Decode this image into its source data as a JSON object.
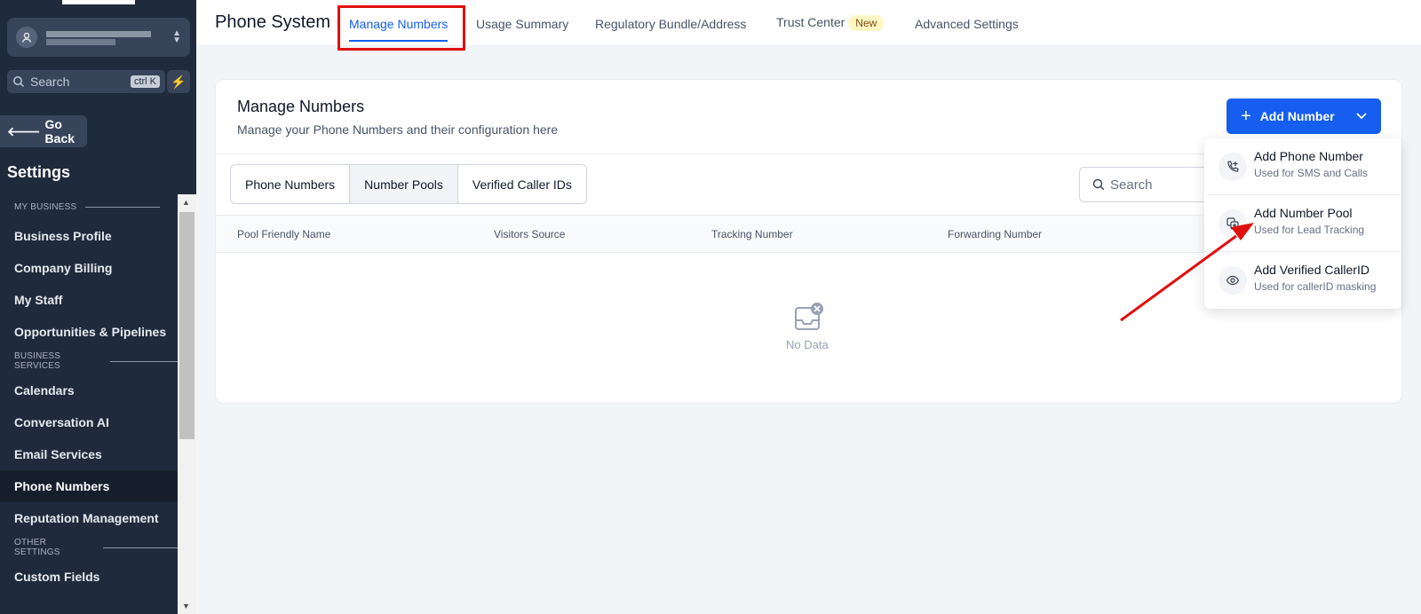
{
  "sidebar": {
    "search_placeholder": "Search",
    "search_shortcut": "ctrl K",
    "go_back": "Go Back",
    "settings_title": "Settings",
    "sections": [
      {
        "label": "MY BUSINESS",
        "items": [
          "Business Profile",
          "Company Billing",
          "My Staff",
          "Opportunities & Pipelines"
        ]
      },
      {
        "label": "BUSINESS SERVICES",
        "items": [
          "Calendars",
          "Conversation AI",
          "Email Services",
          "Phone Numbers",
          "Reputation Management"
        ]
      },
      {
        "label": "OTHER SETTINGS",
        "items": [
          "Custom Fields"
        ]
      }
    ],
    "active_item": "Phone Numbers"
  },
  "header": {
    "title": "Phone System",
    "tabs": [
      "Manage Numbers",
      "Usage Summary",
      "Regulatory Bundle/Address",
      "Trust Center",
      "Advanced Settings"
    ],
    "trust_center_badge": "New",
    "active_tab": "Manage Numbers"
  },
  "card": {
    "title": "Manage Numbers",
    "subtitle": "Manage your Phone Numbers and their configuration here",
    "add_button": "Add Number",
    "segments": [
      "Phone Numbers",
      "Number Pools",
      "Verified Caller IDs"
    ],
    "active_segment": "Number Pools",
    "search_placeholder": "Search",
    "columns": [
      "Pool Friendly Name",
      "Visitors Source",
      "Tracking Number",
      "Forwarding Number"
    ],
    "empty_text": "No Data"
  },
  "dropdown": {
    "items": [
      {
        "label": "Add Phone Number",
        "sub": "Used for SMS and Calls",
        "icon": "phone-plus-icon"
      },
      {
        "label": "Add Number Pool",
        "sub": "Used for Lead Tracking",
        "icon": "copy-plus-icon"
      },
      {
        "label": "Add Verified CallerID",
        "sub": "Used for callerID masking",
        "icon": "eye-icon"
      }
    ]
  },
  "colors": {
    "accent": "#155eef",
    "sidebar_bg": "#1f2a3c",
    "annotation": "#e01010"
  }
}
